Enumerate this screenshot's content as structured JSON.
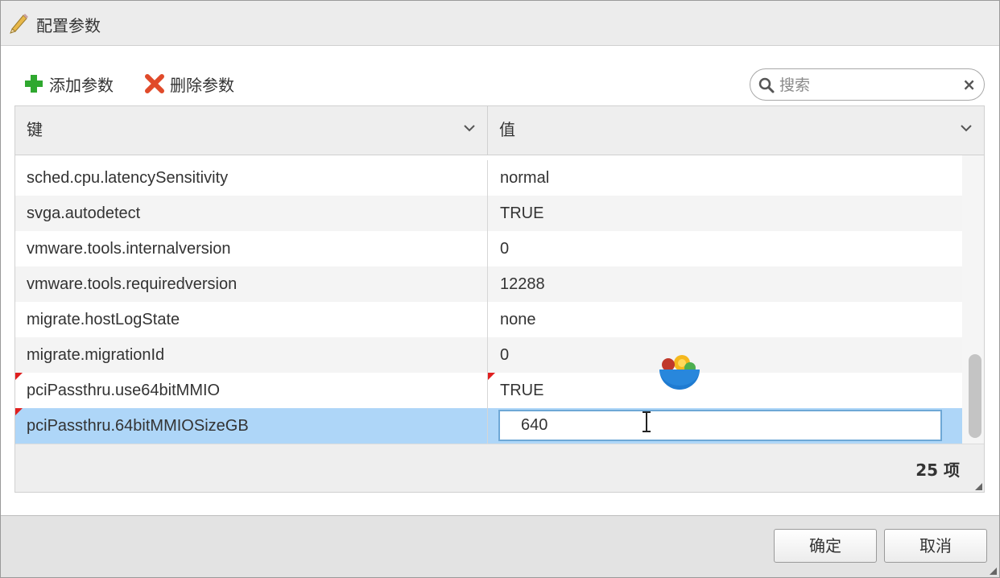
{
  "dialog": {
    "title": "配置参数"
  },
  "toolbar": {
    "add_label": "添加参数",
    "delete_label": "删除参数"
  },
  "search": {
    "placeholder": "搜索",
    "value": ""
  },
  "table": {
    "columns": [
      "键",
      "值"
    ],
    "rows": [
      {
        "key": "sched.cpu.latencySensitivity",
        "value": "normal",
        "modified": false
      },
      {
        "key": "svga.autodetect",
        "value": "TRUE",
        "modified": false
      },
      {
        "key": "vmware.tools.internalversion",
        "value": "0",
        "modified": false
      },
      {
        "key": "vmware.tools.requiredversion",
        "value": "12288",
        "modified": false
      },
      {
        "key": "migrate.hostLogState",
        "value": "none",
        "modified": false
      },
      {
        "key": "migrate.migrationId",
        "value": "0",
        "modified": false
      },
      {
        "key": "pciPassthru.use64bitMMIO",
        "value": "TRUE",
        "modified": true
      },
      {
        "key": "pciPassthru.64bitMMIOSizeGB",
        "value": "640",
        "modified": true,
        "selected": true,
        "editing": true
      }
    ],
    "item_count_label": "25 项"
  },
  "footer": {
    "ok_label": "确定",
    "cancel_label": "取消"
  }
}
